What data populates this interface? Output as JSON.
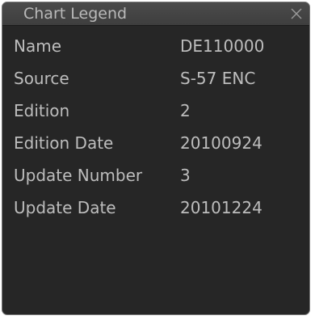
{
  "window": {
    "title": "Chart Legend",
    "close_icon": "close-icon"
  },
  "rows": [
    {
      "label": "Name",
      "value": "DE110000"
    },
    {
      "label": "Source",
      "value": "S-57 ENC"
    },
    {
      "label": "Edition",
      "value": "2"
    },
    {
      "label": "Edition Date",
      "value": "20100924"
    },
    {
      "label": "Update Number",
      "value": "3"
    },
    {
      "label": "Update Date",
      "value": "20101224"
    }
  ],
  "colors": {
    "background": "#262626",
    "titlebar": "#444444",
    "text": "#bdbdbd"
  }
}
